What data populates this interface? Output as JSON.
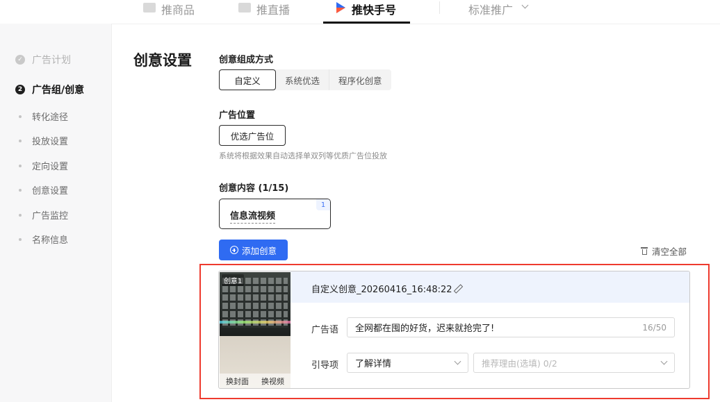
{
  "topnav": {
    "tabs": [
      {
        "label": "推商品",
        "icon": "megaphone-icon"
      },
      {
        "label": "推直播",
        "icon": "live-icon"
      },
      {
        "label": "推快手号",
        "icon": "kuaishou-play-icon"
      },
      {
        "label": "标准推广",
        "icon": "chevron-down-icon"
      }
    ],
    "active_tab": "推快手号"
  },
  "sidebar": {
    "steps": [
      {
        "label": "广告计划",
        "state": "done",
        "icon": "check-circle-icon"
      },
      {
        "label": "广告组/创意",
        "state": "current",
        "number": "2"
      }
    ],
    "items": [
      {
        "label": "转化途径"
      },
      {
        "label": "投放设置"
      },
      {
        "label": "定向设置"
      },
      {
        "label": "创意设置"
      },
      {
        "label": "广告监控"
      },
      {
        "label": "名称信息"
      }
    ]
  },
  "main": {
    "title": "创意设置",
    "composition": {
      "label": "创意组成方式",
      "options": [
        "自定义",
        "系统优选",
        "程序化创意"
      ],
      "selected": "自定义"
    },
    "placement": {
      "label": "广告位置",
      "button": "优选广告位",
      "hint": "系统将根据效果自动选择单双列等优质广告位投放"
    },
    "content": {
      "label": "创意内容 (1/15)",
      "card_label": "信息流视频",
      "card_badge": "1"
    },
    "add_button": "添加创意",
    "clear_all": "清空全部",
    "creative": {
      "tag": "创意1",
      "name": "自定义创意_20260416_16:48:22",
      "replace_cover": "换封面",
      "replace_video": "换视频",
      "ad_text_label": "广告语",
      "ad_text_value": "全网都在囤的好货，迟来就抢完了!",
      "ad_text_count": "16/50",
      "cta_label": "引导项",
      "cta_value": "了解详情",
      "reason_placeholder": "推荐理由(选填) 0/2"
    }
  },
  "colors": {
    "accent": "#2f6bf2",
    "highlight_box": "#ee3a2e",
    "header_tint": "#eef3fd"
  }
}
